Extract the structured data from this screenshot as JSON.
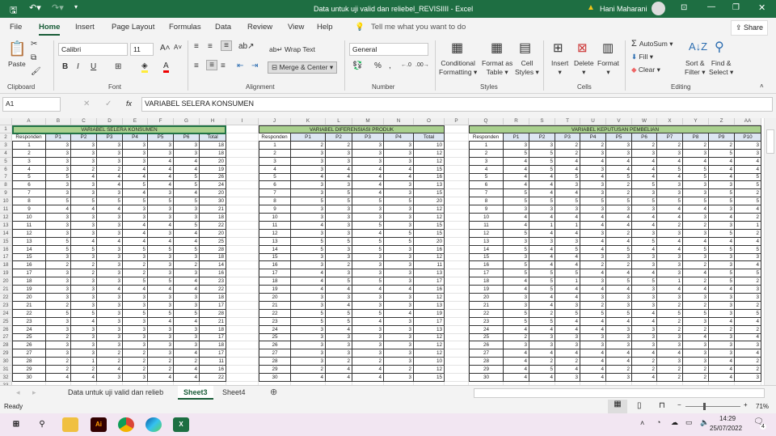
{
  "titlebar": {
    "doc_title": "Data untuk uji valid dan reliebel_REVISIIII  -  Excel",
    "user": "Hani Maharani"
  },
  "menu": [
    "File",
    "Home",
    "Insert",
    "Page Layout",
    "Formulas",
    "Data",
    "Review",
    "View",
    "Help"
  ],
  "tell_me": "Tell me what you want to do",
  "share": "Share",
  "ribbon": {
    "paste": "Paste",
    "font_name": "Calibri",
    "font_size": "11",
    "wrap_text": "Wrap Text",
    "merge_center": "Merge & Center",
    "number_format": "General",
    "percent": "%",
    "comma": ",",
    "conditional_formatting": [
      "Conditional",
      "Formatting"
    ],
    "format_as_table": [
      "Format as",
      "Table"
    ],
    "cell_styles": [
      "Cell",
      "Styles"
    ],
    "insert": "Insert",
    "delete": "Delete",
    "format": "Format",
    "autosum": "AutoSum",
    "fill": "Fill",
    "clear": "Clear",
    "sort_filter": [
      "Sort &",
      "Filter"
    ],
    "find_select": [
      "Find &",
      "Select"
    ],
    "groups": [
      "Clipboard",
      "Font",
      "Alignment",
      "Number",
      "Styles",
      "Cells",
      "Editing"
    ]
  },
  "formula_bar": {
    "name_box": "A1",
    "fx": "fx",
    "content": "VARIABEL SELERA KONSUMEN"
  },
  "columns": [
    "A",
    "B",
    "C",
    "D",
    "E",
    "F",
    "G",
    "H",
    "I",
    "J",
    "K",
    "L",
    "M",
    "N",
    "O",
    "P",
    "Q",
    "R",
    "S",
    "T",
    "U",
    "V",
    "W",
    "X",
    "Y",
    "Z",
    "AA"
  ],
  "row_headers": [
    "1",
    "2",
    "3",
    "4",
    "5",
    "6",
    "7",
    "8",
    "9",
    "10",
    "11",
    "12",
    "13",
    "14",
    "15",
    "16",
    "17",
    "18",
    "19",
    "20",
    "21",
    "22",
    "23",
    "24",
    "25",
    "26",
    "27",
    "28",
    "29",
    "30",
    "31",
    "32",
    "33"
  ],
  "tables": [
    {
      "title": "VARIABEL SELERA KONSUMEN",
      "headers": [
        "Responden",
        "P1",
        "P2",
        "P3",
        "P4",
        "P5",
        "P6",
        "Total"
      ],
      "rows": [
        [
          1,
          3,
          3,
          3,
          3,
          3,
          3,
          18
        ],
        [
          2,
          3,
          3,
          3,
          3,
          3,
          3,
          18
        ],
        [
          3,
          3,
          3,
          3,
          3,
          4,
          4,
          20
        ],
        [
          4,
          3,
          2,
          2,
          4,
          4,
          4,
          19
        ],
        [
          5,
          5,
          4,
          4,
          4,
          4,
          5,
          26
        ],
        [
          6,
          3,
          3,
          4,
          5,
          4,
          5,
          24
        ],
        [
          7,
          3,
          3,
          3,
          4,
          3,
          4,
          20
        ],
        [
          8,
          5,
          5,
          5,
          5,
          5,
          5,
          30
        ],
        [
          9,
          4,
          4,
          4,
          3,
          3,
          3,
          21
        ],
        [
          10,
          3,
          3,
          3,
          3,
          3,
          3,
          18
        ],
        [
          11,
          3,
          3,
          3,
          4,
          4,
          5,
          22
        ],
        [
          12,
          3,
          3,
          3,
          4,
          3,
          4,
          20
        ],
        [
          13,
          5,
          4,
          4,
          4,
          4,
          4,
          25
        ],
        [
          14,
          5,
          5,
          3,
          5,
          5,
          5,
          28
        ],
        [
          15,
          3,
          3,
          3,
          3,
          3,
          3,
          18
        ],
        [
          16,
          2,
          2,
          3,
          2,
          3,
          2,
          14
        ],
        [
          17,
          3,
          2,
          3,
          2,
          3,
          3,
          16
        ],
        [
          18,
          3,
          3,
          3,
          5,
          5,
          4,
          23
        ],
        [
          19,
          3,
          3,
          4,
          4,
          4,
          4,
          22
        ],
        [
          20,
          3,
          3,
          3,
          3,
          3,
          3,
          18
        ],
        [
          21,
          2,
          3,
          3,
          3,
          3,
          3,
          17
        ],
        [
          22,
          5,
          5,
          3,
          5,
          5,
          5,
          28
        ],
        [
          23,
          3,
          4,
          3,
          3,
          4,
          4,
          21
        ],
        [
          24,
          3,
          3,
          3,
          3,
          3,
          3,
          18
        ],
        [
          25,
          2,
          3,
          3,
          3,
          3,
          3,
          17
        ],
        [
          26,
          3,
          3,
          3,
          3,
          3,
          3,
          18
        ],
        [
          27,
          3,
          3,
          2,
          2,
          3,
          4,
          17
        ],
        [
          28,
          2,
          1,
          2,
          2,
          2,
          2,
          11
        ],
        [
          29,
          2,
          2,
          4,
          2,
          2,
          4,
          16
        ],
        [
          30,
          4,
          4,
          3,
          3,
          4,
          4,
          22
        ]
      ]
    },
    {
      "title": "VARIABEL DIFERENSIASI PRODUK",
      "headers": [
        "Responden",
        "P1",
        "P2",
        "P3",
        "P4",
        "Total"
      ],
      "rows": [
        [
          1,
          2,
          2,
          3,
          3,
          10
        ],
        [
          2,
          3,
          3,
          3,
          3,
          12
        ],
        [
          3,
          3,
          3,
          3,
          3,
          12
        ],
        [
          4,
          3,
          4,
          4,
          4,
          15
        ],
        [
          5,
          4,
          4,
          4,
          4,
          16
        ],
        [
          6,
          3,
          3,
          4,
          3,
          13
        ],
        [
          7,
          3,
          5,
          4,
          3,
          15
        ],
        [
          8,
          5,
          5,
          5,
          5,
          20
        ],
        [
          9,
          3,
          3,
          3,
          3,
          12
        ],
        [
          10,
          3,
          3,
          3,
          3,
          12
        ],
        [
          11,
          4,
          3,
          5,
          3,
          15
        ],
        [
          12,
          3,
          3,
          4,
          5,
          15
        ],
        [
          13,
          5,
          5,
          5,
          5,
          20
        ],
        [
          14,
          5,
          3,
          5,
          3,
          16
        ],
        [
          15,
          3,
          3,
          3,
          3,
          12
        ],
        [
          16,
          3,
          2,
          3,
          3,
          11
        ],
        [
          17,
          4,
          3,
          3,
          3,
          13
        ],
        [
          18,
          4,
          5,
          5,
          3,
          17
        ],
        [
          19,
          4,
          4,
          4,
          4,
          16
        ],
        [
          20,
          3,
          3,
          3,
          3,
          12
        ],
        [
          21,
          3,
          4,
          3,
          3,
          13
        ],
        [
          22,
          5,
          5,
          5,
          4,
          19
        ],
        [
          23,
          5,
          5,
          4,
          3,
          17
        ],
        [
          24,
          3,
          4,
          3,
          3,
          13
        ],
        [
          25,
          3,
          3,
          3,
          3,
          12
        ],
        [
          26,
          3,
          3,
          3,
          3,
          12
        ],
        [
          27,
          3,
          3,
          3,
          3,
          12
        ],
        [
          28,
          3,
          2,
          2,
          3,
          10
        ],
        [
          29,
          2,
          4,
          4,
          2,
          12
        ],
        [
          30,
          4,
          4,
          4,
          3,
          15
        ]
      ]
    },
    {
      "title": "VARIABEL KEPUTUSAN PEMBELIAN",
      "headers": [
        "Responden",
        "P1",
        "P2",
        "P3",
        "P4",
        "P5",
        "P6",
        "P7",
        "P8",
        "P9",
        "P10"
      ],
      "rows": [
        [
          1,
          3,
          3,
          2,
          2,
          3,
          2,
          2,
          2,
          2,
          3
        ],
        [
          2,
          5,
          5,
          2,
          3,
          3,
          3,
          3,
          3,
          5,
          3
        ],
        [
          3,
          4,
          5,
          4,
          4,
          4,
          4,
          4,
          4,
          4,
          4
        ],
        [
          4,
          4,
          5,
          4,
          3,
          4,
          4,
          5,
          5,
          4,
          4
        ],
        [
          5,
          4,
          4,
          5,
          4,
          5,
          4,
          4,
          5,
          4,
          5
        ],
        [
          6,
          4,
          4,
          3,
          3,
          2,
          5,
          3,
          3,
          3,
          5
        ],
        [
          7,
          5,
          4,
          4,
          3,
          2,
          3,
          3,
          3,
          5,
          2
        ],
        [
          8,
          5,
          5,
          5,
          5,
          5,
          5,
          5,
          5,
          5,
          5
        ],
        [
          9,
          3,
          3,
          3,
          3,
          3,
          3,
          4,
          4,
          3,
          4
        ],
        [
          10,
          4,
          4,
          4,
          4,
          4,
          4,
          4,
          3,
          4,
          2
        ],
        [
          11,
          4,
          1,
          1,
          4,
          4,
          4,
          2,
          2,
          3,
          1
        ],
        [
          12,
          5,
          4,
          4,
          3,
          2,
          3,
          3,
          3,
          5,
          2
        ],
        [
          13,
          3,
          3,
          3,
          4,
          4,
          5,
          4,
          4,
          4,
          4
        ],
        [
          14,
          5,
          4,
          5,
          4,
          5,
          4,
          4,
          5,
          5,
          5
        ],
        [
          15,
          3,
          4,
          4,
          3,
          3,
          3,
          3,
          3,
          3,
          3
        ],
        [
          16,
          5,
          4,
          4,
          2,
          2,
          3,
          3,
          2,
          3,
          4
        ],
        [
          17,
          5,
          5,
          5,
          4,
          4,
          4,
          3,
          4,
          5,
          5
        ],
        [
          18,
          4,
          5,
          1,
          3,
          5,
          5,
          1,
          2,
          5,
          2
        ],
        [
          19,
          4,
          5,
          4,
          4,
          4,
          3,
          4,
          4,
          4,
          3
        ],
        [
          20,
          3,
          4,
          4,
          3,
          3,
          3,
          3,
          3,
          3,
          3
        ],
        [
          21,
          3,
          4,
          3,
          2,
          3,
          3,
          2,
          2,
          3,
          2
        ],
        [
          22,
          5,
          2,
          5,
          5,
          5,
          4,
          5,
          5,
          3,
          5
        ],
        [
          23,
          5,
          5,
          4,
          4,
          4,
          4,
          2,
          3,
          4,
          4
        ],
        [
          24,
          4,
          4,
          4,
          4,
          3,
          3,
          2,
          2,
          2,
          2
        ],
        [
          25,
          2,
          3,
          3,
          3,
          3,
          3,
          3,
          4,
          3,
          4
        ],
        [
          26,
          3,
          3,
          3,
          3,
          3,
          3,
          3,
          3,
          3,
          3
        ],
        [
          27,
          4,
          4,
          4,
          4,
          4,
          4,
          4,
          3,
          3,
          4
        ],
        [
          28,
          4,
          2,
          2,
          4,
          4,
          2,
          3,
          3,
          4,
          2
        ],
        [
          29,
          4,
          5,
          4,
          4,
          2,
          2,
          2,
          2,
          4,
          2
        ],
        [
          30,
          4,
          4,
          3,
          4,
          3,
          4,
          2,
          2,
          4,
          3
        ]
      ]
    }
  ],
  "sheet_tabs": [
    "Data untuk uji valid dan relieb",
    "Sheet3",
    "Sheet4"
  ],
  "active_sheet": "Sheet3",
  "status": {
    "ready": "Ready",
    "zoom": "71%"
  },
  "taskbar": {
    "time": "14:29",
    "date": "25/07/2022",
    "notifications": "4",
    "ai_label": "Ai",
    "excel_label": "X"
  },
  "colors": {
    "title_green": "#1e6e42",
    "header_green": "#a9d08e",
    "header_blue": "#dde6f2"
  }
}
